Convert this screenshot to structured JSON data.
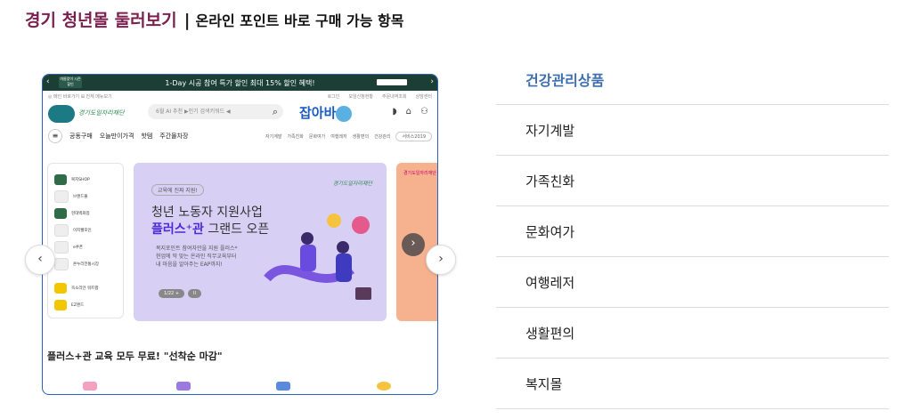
{
  "header": {
    "title": "경기 청년몰 둘러보기",
    "separator": "|",
    "subtitle": "온라인 포인트 바로 구매 가능 항목"
  },
  "preview": {
    "topbar": {
      "promo": "1-Day 시공 참여 특가 할인  최대 15% 할인 혜택!",
      "left_logo": "여름맞이 시즌할인"
    },
    "utility": {
      "left": "◎ 메인 바로가기    ⊞ 전체 메뉴보기",
      "right": [
        "로그인",
        "모임신청현황",
        "주문내역조회",
        "상담센터"
      ]
    },
    "search": {
      "placeholder": "6월 AI 추천 ▶인기 검색키워드 ◀"
    },
    "brand": {
      "left_logo": "경기도일자리재단",
      "center": "잡아바",
      "site_name": "경기도일자리재단"
    },
    "nav": {
      "items": [
        "공동구매",
        "오늘만이가격",
        "핫템",
        "주간몰차장"
      ],
      "right": [
        "자기계발",
        "가족친화",
        "문화여가",
        "여행레저",
        "생활편의",
        "건강관리"
      ],
      "select": "서비스2019"
    },
    "side_items": [
      "복지SHOP",
      "브랜드몰",
      "현대백화점",
      "이지웰포인",
      "e쿠폰",
      "온누리전통시장",
      "옥소리안 워트랩",
      "EZ랜드"
    ],
    "banner": {
      "tag": "교육에 진짜 지원!",
      "line1": "청년 노동자 지원사업",
      "line2_highlight": "플러스⁺관",
      "line2_rest": " 그랜드 오픈",
      "desc": [
        "복지포인트 참여자만을 지원 플러스*",
        "현업에 딱 맞는 온라인 직무교육부터",
        "내 마음을 알아주는 EAP까지!"
      ],
      "page": "1/22 +",
      "pause": "II",
      "logo": "경기도일자리재단"
    },
    "peach_text": "경기도일자리재단",
    "bottom_text": "플러스+관 교육 모두 무료! \"선착순 마감\""
  },
  "categories": {
    "active": "건강관리상품",
    "items": [
      "자기계발",
      "가족친화",
      "문화여가",
      "여행레저",
      "생활편의",
      "복지몰"
    ]
  },
  "colors": {
    "title": "#7a1f4e",
    "active_category": "#3d6fb0",
    "frame_border": "#2a62b8",
    "topbar": "#1b3f35"
  }
}
